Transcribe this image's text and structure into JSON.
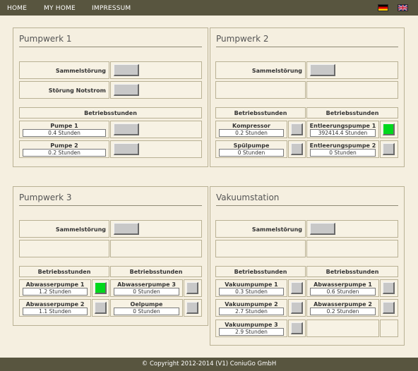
{
  "nav": {
    "home": "HOME",
    "my_home": "MY HOME",
    "impressum": "IMPRESSUM"
  },
  "languages": [
    "Deutsch",
    "English"
  ],
  "footer": {
    "copyright": "© Copyright 2012-2014 (V1) ConiuGo GmbH"
  },
  "colors": {
    "header_bg": "#58553f",
    "page_bg": "#f5efe0",
    "status_on": "#00d81c",
    "status_off": "#c8c8c8"
  },
  "pumpwerk1": {
    "title": "Pumpwerk 1",
    "sammelstoerung": "Sammelstörung",
    "stoerung_notstrom": "Störung Notstrom",
    "betriebsstunden": "Betriebsstunden",
    "pumpe1": {
      "name": "Pumpe 1",
      "value": "0.4 Stunden",
      "status": "off"
    },
    "pumpe2": {
      "name": "Pumpe 2",
      "value": "0.2 Stunden",
      "status": "off"
    }
  },
  "pumpwerk2": {
    "title": "Pumpwerk 2",
    "sammelstoerung": "Sammelstörung",
    "betriebsstunden_left": "Betriebsstunden",
    "betriebsstunden_right": "Betriebsstunden",
    "kompressor": {
      "name": "Kompressor",
      "value": "0.2 Stunden",
      "status": "off"
    },
    "spuelpumpe": {
      "name": "Spülpumpe",
      "value": "0 Stunden",
      "status": "off"
    },
    "entleerungspumpe1": {
      "name": "Entleerungspumpe 1",
      "value": "392414.4 Stunden",
      "status": "on"
    },
    "entleerungspumpe2": {
      "name": "Entleerungspumpe 2",
      "value": "0 Stunden",
      "status": "off"
    }
  },
  "pumpwerk3": {
    "title": "Pumpwerk 3",
    "sammelstoerung": "Sammelstörung",
    "betriebsstunden_left": "Betriebsstunden",
    "betriebsstunden_right": "Betriebsstunden",
    "abwasserpumpe1": {
      "name": "Abwasserpumpe 1",
      "value": "1.2 Stunden",
      "status": "on"
    },
    "abwasserpumpe2": {
      "name": "Abwasserpumpe 2",
      "value": "1.1 Stunden",
      "status": "off"
    },
    "abwasserpumpe3": {
      "name": "Abwasserpumpe 3",
      "value": "0 Stunden",
      "status": "off"
    },
    "oelpumpe": {
      "name": "Oelpumpe",
      "value": "0 Stunden",
      "status": "off"
    }
  },
  "vakuumstation": {
    "title": "Vakuumstation",
    "sammelstoerung": "Sammelstörung",
    "betriebsstunden_left": "Betriebsstunden",
    "betriebsstunden_right": "Betriebsstunden",
    "vakuumpumpe1": {
      "name": "Vakuumpumpe 1",
      "value": "0.3 Stunden",
      "status": "off"
    },
    "vakuumpumpe2": {
      "name": "Vakuumpumpe 2",
      "value": "2.7 Stunden",
      "status": "off"
    },
    "vakuumpumpe3": {
      "name": "Vakuumpumpe 3",
      "value": "2.9 Stunden",
      "status": "off"
    },
    "abwasserpumpe1": {
      "name": "Abwasserpumpe 1",
      "value": "0.6 Stunden",
      "status": "off"
    },
    "abwasserpumpe2": {
      "name": "Abwasserpumpe 2",
      "value": "0.2 Stunden",
      "status": "off"
    }
  }
}
